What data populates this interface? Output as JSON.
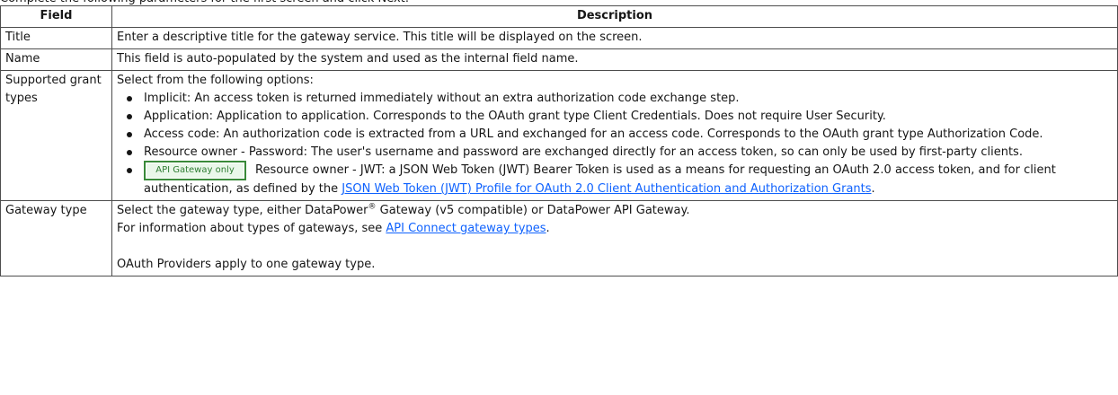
{
  "intro": "Complete the following parameters for the first screen and click Next:",
  "table": {
    "headers": [
      "Field",
      "Description"
    ],
    "rows": {
      "title": {
        "field": "Title",
        "description": "Enter a descriptive title for the gateway service. This title will be displayed on the screen."
      },
      "name": {
        "field": "Name",
        "description": "This field is auto-populated by the system and used as the internal field name."
      },
      "grant_types": {
        "field": "Supported grant types",
        "description": "Select from the following options:",
        "options": [
          "Implicit: An access token is returned immediately without an extra authorization code exchange step.",
          "Application: Application to application. Corresponds to the OAuth grant type Client Credentials. Does not require User Security.",
          "Access code: An authorization code is extracted from a URL and exchanged for an access code. Corresponds to the OAuth grant type Authorization Code.",
          "Resource owner - Password: The user's username and password are exchanged directly for an access token, so can only be used by first-party clients."
        ],
        "jwt_option": {
          "badge": "API Gateway only",
          "text": "Resource owner - JWT: a JSON Web Token (JWT) Bearer Token is used as a means for requesting an OAuth 2.0 access token, and for client authentication, as defined by the",
          "link": "JSON Web Token (JWT) Profile for OAuth 2.0 Client Authentication and Authorization Grants",
          "end": "."
        }
      },
      "gateway_type": {
        "field": "Gateway type",
        "line1_a": "Select the gateway type, either DataPower",
        "line1_reg": "®",
        "line1_b": " Gateway (v5 compatible) or DataPower API Gateway.",
        "line2_a": "For information about types of gateways, see ",
        "line2_link": "API Connect gateway types",
        "line2_end": ".",
        "line3": "OAuth Providers apply to one gateway type."
      }
    }
  },
  "colors": {
    "link": "#0f62fe",
    "border": "#4d4d4d",
    "badge_border": "#3a8a3a",
    "badge_text": "#2e7d32"
  }
}
